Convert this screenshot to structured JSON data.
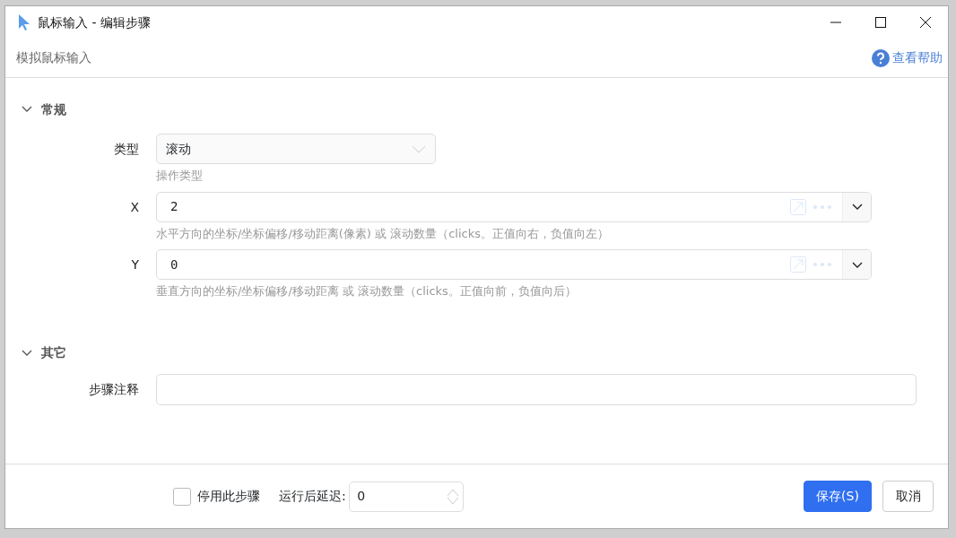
{
  "window": {
    "title": "鼠标输入 - 编辑步骤"
  },
  "header": {
    "subtitle": "模拟鼠标输入",
    "help_link": "查看帮助"
  },
  "sections": [
    {
      "title": "常规",
      "expanded": true,
      "fields": [
        {
          "kind": "select",
          "label": "类型",
          "value": "滚动",
          "hint": "操作类型"
        },
        {
          "kind": "expression",
          "label": "X",
          "value": "2",
          "hint": "水平方向的坐标/坐标偏移/移动距离(像素) 或 滚动数量（clicks。正值向右，负值向左）"
        },
        {
          "kind": "expression",
          "label": "Y",
          "value": "0",
          "hint": "垂直方向的坐标/坐标偏移/移动距离 或 滚动数量（clicks。正值向前，负值向后）"
        }
      ]
    },
    {
      "title": "其它",
      "expanded": true,
      "fields": [
        {
          "kind": "text",
          "label": "步骤注释"
        }
      ]
    }
  ],
  "footer": {
    "disable": {
      "label": "停用此步骤",
      "checked": false
    },
    "delay": {
      "label": "运行后延迟:",
      "value": "0"
    },
    "buttons": [
      {
        "label": "保存(S)",
        "kind": "primary"
      },
      {
        "label": "取消",
        "kind": "secondary"
      }
    ]
  }
}
